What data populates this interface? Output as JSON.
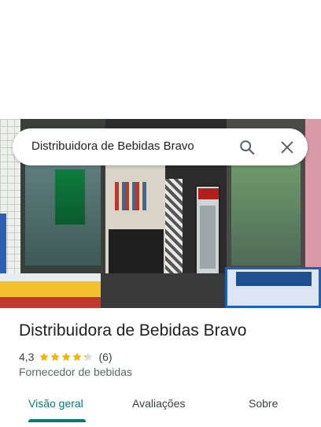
{
  "search": {
    "query": "Distribuidora de Bebidas Bravo",
    "search_icon": "search-icon",
    "close_icon": "close-icon"
  },
  "photo": {
    "description_icon": "storefront-photo"
  },
  "place": {
    "name": "Distribuidora de Bebidas Bravo",
    "rating": "4,3",
    "rating_value": 4.3,
    "stars_max": 5,
    "review_count": "(6)",
    "category": "Fornecedor de bebidas"
  },
  "tabs": [
    {
      "label": "Visão geral",
      "active": true
    },
    {
      "label": "Avaliações",
      "active": false
    },
    {
      "label": "Sobre",
      "active": false
    }
  ],
  "colors": {
    "accent": "#0b7a75",
    "star": "#f4b400",
    "star_empty": "#dadce0",
    "text_primary": "#202124",
    "text_secondary": "#5f6368"
  }
}
